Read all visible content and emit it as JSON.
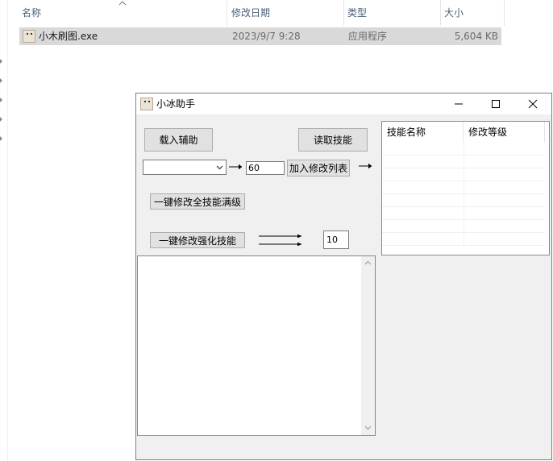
{
  "explorer": {
    "columns": {
      "name": "名称",
      "modified": "修改日期",
      "type": "类型",
      "size": "大小"
    },
    "file": {
      "name": "小木刷图.exe",
      "modified": "2023/9/7 9:28",
      "type": "应用程序",
      "size": "5,604 KB"
    }
  },
  "app": {
    "title": "小冰助手",
    "buttons": {
      "load_assist": "载入辅助",
      "read_skills": "读取技能",
      "add_to_list": "加入修改列表",
      "max_all_skills": "一键修改全技能满级",
      "modify_enhanced": "一键修改强化技能"
    },
    "inputs": {
      "skill_select": "",
      "level_value": "60",
      "enhance_value": "10"
    },
    "table": {
      "headers": [
        "技能名称",
        "修改等级"
      ],
      "rows": []
    },
    "log_text": ""
  }
}
